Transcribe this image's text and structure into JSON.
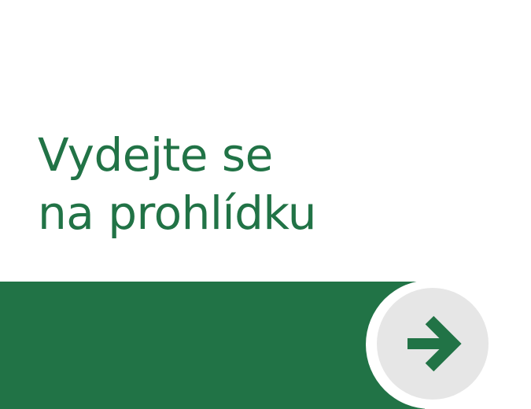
{
  "intro": {
    "title_line1": "Vydejte se",
    "title_line2": "na prohlídku"
  },
  "next_button": {
    "icon": "arrow-right-icon"
  },
  "colors": {
    "accent": "#217346",
    "button_bg": "#e6e6e6",
    "background": "#ffffff"
  }
}
